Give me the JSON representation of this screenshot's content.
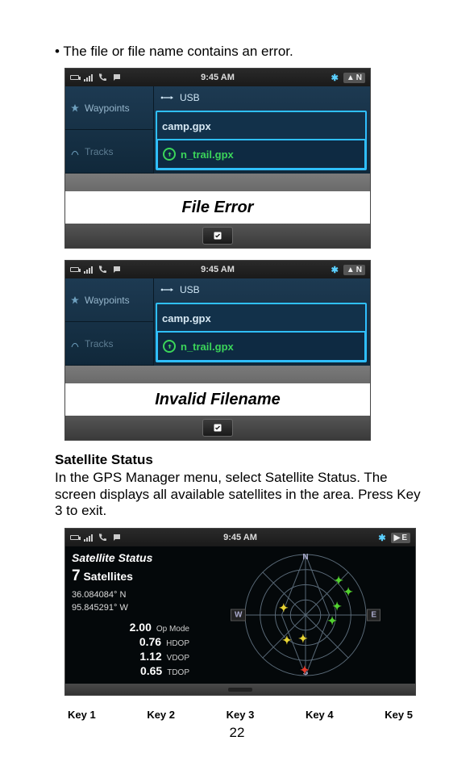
{
  "bullet": "The file or file name contains an error.",
  "status": {
    "time": "9:45 AM",
    "mode": "N",
    "sat_mode": "E"
  },
  "left_items": [
    "Waypoints",
    "Tracks"
  ],
  "usb_label": "USB",
  "files": [
    "camp.gpx",
    "n_trail.gpx"
  ],
  "msg1": "File Error",
  "msg2": "Invalid Filename",
  "sat_heading": "Satellite Status",
  "sat_para": "In the GPS Manager menu, select Satellite Status. The screen displays all available satellites in the area. Press Key 3 to exit.",
  "sat": {
    "title": "Satellite Status",
    "count_num": "7",
    "count_label": "Satellites",
    "lat": "36.084084° N",
    "lon": "95.845291° W",
    "op_v": "2.00",
    "op_l": "Op Mode",
    "hdop_v": "0.76",
    "hdop_l": "HDOP",
    "vdop_v": "1.12",
    "vdop_l": "VDOP",
    "tdop_v": "0.65",
    "tdop_l": "TDOP",
    "compass": {
      "n": "N",
      "s": "S",
      "e": "E",
      "w": "W"
    }
  },
  "keys": [
    "Key 1",
    "Key 2",
    "Key 3",
    "Key 4",
    "Key 5"
  ],
  "page": "22"
}
